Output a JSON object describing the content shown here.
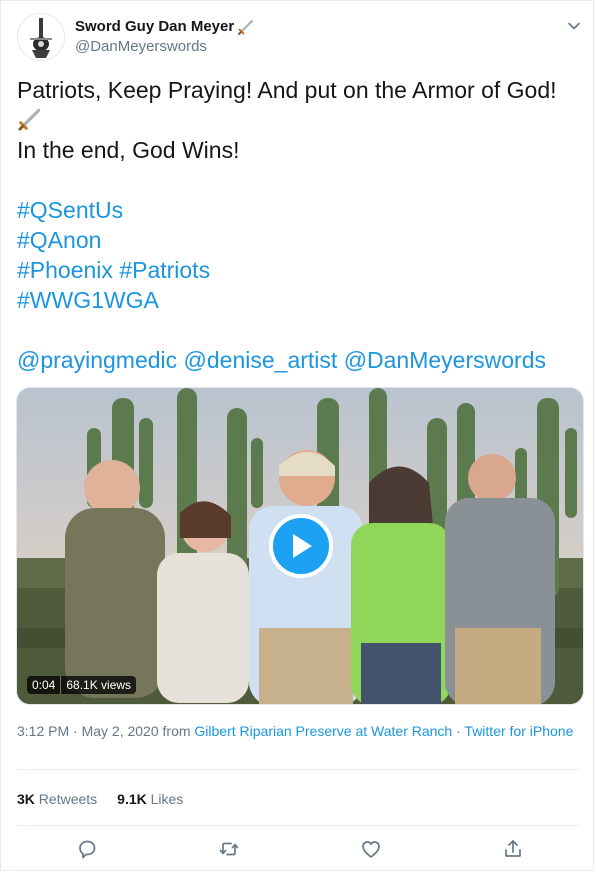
{
  "author": {
    "name": "Sword Guy Dan Meyer",
    "handle": "@DanMeyerswords",
    "name_emoji": "sword-emoji"
  },
  "menu": {
    "icon": "chevron-down-icon"
  },
  "tweet": {
    "line1": "Patriots, Keep Praying! And put on the Armor of God!",
    "line1_emoji": "sword-emoji",
    "line2": "In the end, God Wins!",
    "hashtags": {
      "h1": "#QSentUs",
      "h2": "#QAnon",
      "h3": "#Phoenix",
      "h4": "#Patriots",
      "h5": "#WWG1WGA"
    },
    "mentions": {
      "m1": "@prayingmedic",
      "m2": "@denise_artist",
      "m3": "@DanMeyerswords"
    }
  },
  "video": {
    "duration": "0:04",
    "views": "68.1K views",
    "play_icon": "play-icon"
  },
  "meta": {
    "time": "3:12 PM · May 2, 2020 from ",
    "location": "Gilbert Riparian Preserve at Water Ranch",
    "separator": " · ",
    "source": "Twitter for iPhone"
  },
  "stats": {
    "retweets_count": "3K",
    "retweets_label": "Retweets",
    "likes_count": "9.1K",
    "likes_label": "Likes"
  },
  "actions": [
    "reply-icon",
    "retweet-icon",
    "like-icon",
    "share-icon"
  ],
  "colors": {
    "link": "#1b95e0",
    "accent": "#1da1f2",
    "secondary_text": "#657786",
    "primary_text": "#14171a"
  }
}
